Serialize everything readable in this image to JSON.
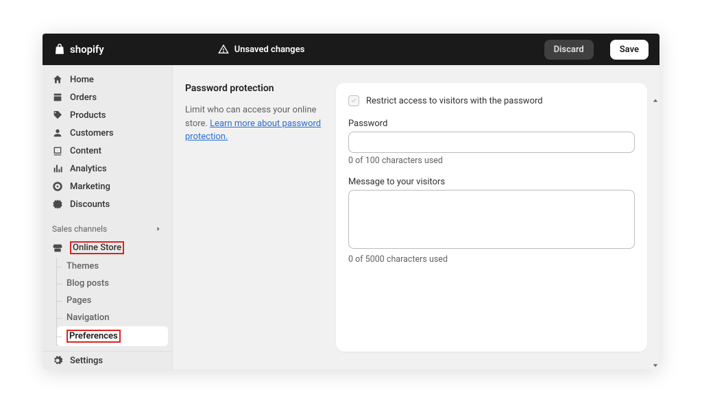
{
  "brand": "shopify",
  "topbar": {
    "unsaved_label": "Unsaved changes",
    "discard_label": "Discard",
    "save_label": "Save"
  },
  "sidebar": {
    "items": [
      {
        "label": "Home"
      },
      {
        "label": "Orders"
      },
      {
        "label": "Products"
      },
      {
        "label": "Customers"
      },
      {
        "label": "Content"
      },
      {
        "label": "Analytics"
      },
      {
        "label": "Marketing"
      },
      {
        "label": "Discounts"
      }
    ],
    "section_label": "Sales channels",
    "online_store": "Online Store",
    "sub_items": [
      {
        "label": "Themes"
      },
      {
        "label": "Blog posts"
      },
      {
        "label": "Pages"
      },
      {
        "label": "Navigation"
      },
      {
        "label": "Preferences"
      }
    ],
    "settings_label": "Settings"
  },
  "content": {
    "title": "Password protection",
    "desc_prefix": "Limit who can access your online store. ",
    "desc_link": "Learn more about password protection.",
    "checkbox_label": "Restrict access to visitors with the password",
    "password_label": "Password",
    "password_counter": "0 of 100 characters used",
    "message_label": "Message to your visitors",
    "message_counter": "0 of 5000 characters used"
  }
}
